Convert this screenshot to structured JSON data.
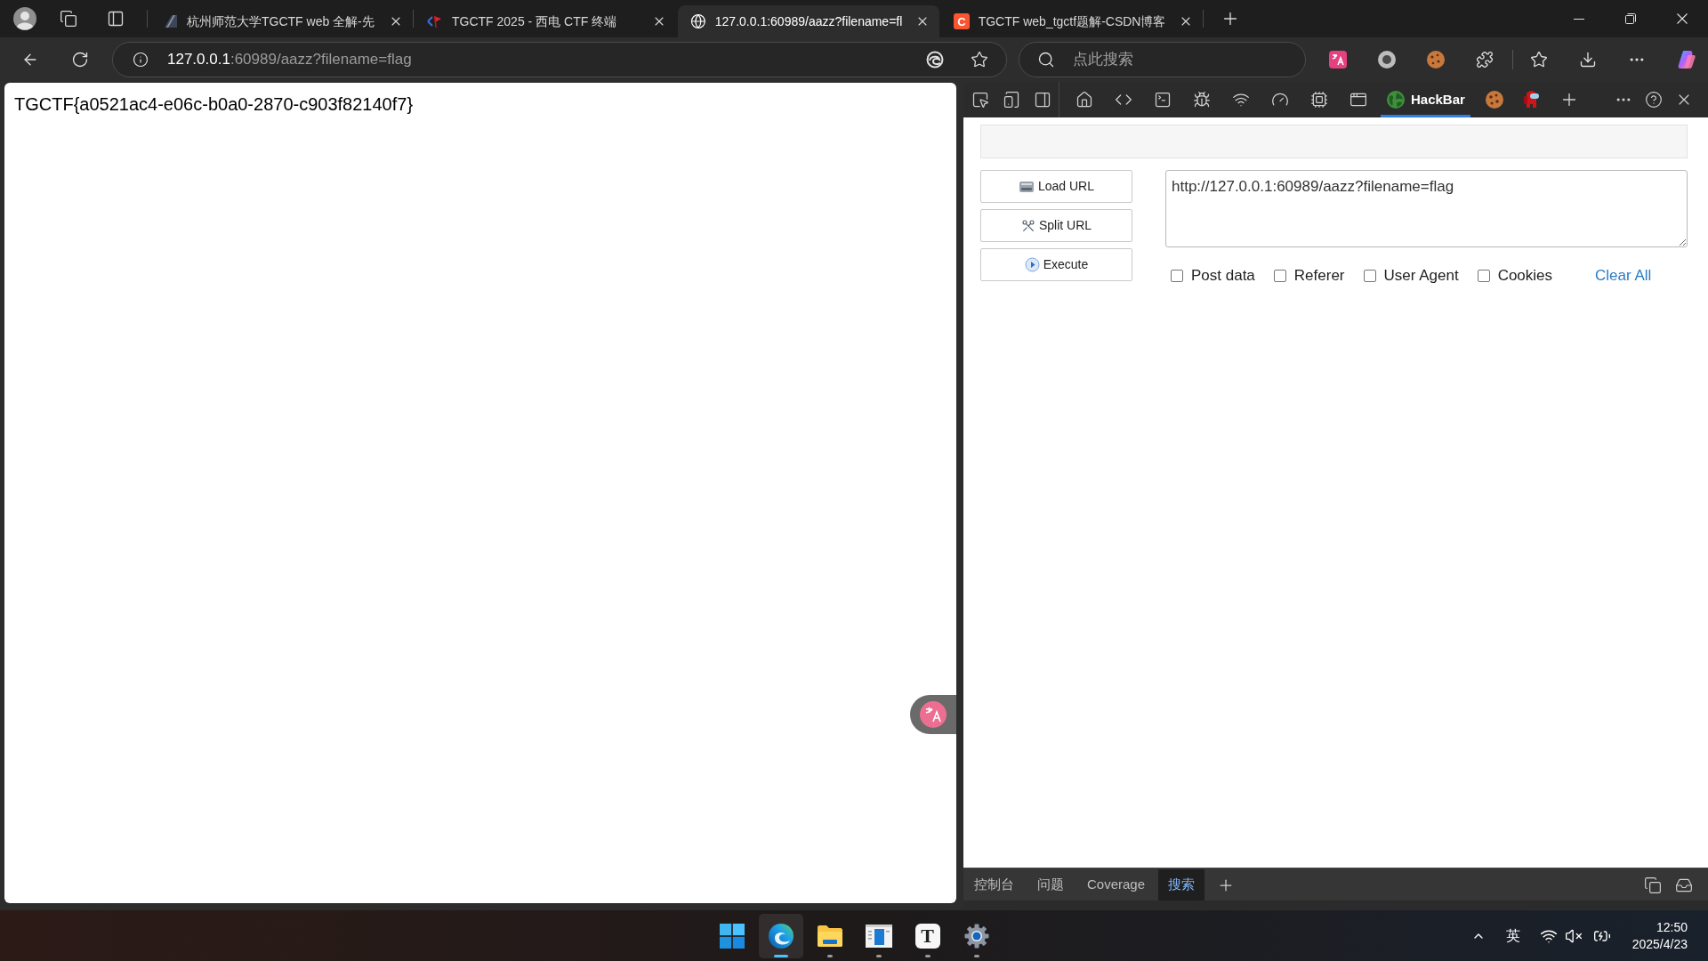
{
  "browser": {
    "tabs": [
      {
        "kind": "slash",
        "title": "杭州师范大学TGCTF web 全解-先",
        "selected": false
      },
      {
        "kind": "flag",
        "title": "TGCTF 2025 - 西电 CTF 终端",
        "selected": false
      },
      {
        "kind": "globe",
        "title": "127.0.0.1:60989/aazz?filename=fl",
        "selected": true
      },
      {
        "kind": "letter",
        "favicon_text": "C",
        "title": "TGCTF web_tgctf题解-CSDN博客",
        "selected": false
      }
    ],
    "address_bar": {
      "host": "127.0.0.1",
      "path": ":60989/aazz?filename=flag"
    },
    "search": {
      "placeholder": "点此搜索"
    }
  },
  "page": {
    "text": "TGCTF{a0521ac4-e06c-b0a0-2870-c903f82140f7}"
  },
  "devtools": {
    "tabs": [
      {
        "label": "HackBar",
        "selected": true
      }
    ],
    "hackbar": {
      "buttons": [
        {
          "kind": "load",
          "label": "Load URL"
        },
        {
          "kind": "split",
          "label": "Split URL"
        },
        {
          "kind": "execute",
          "label": "Execute"
        }
      ],
      "url": "http://127.0.0.1:60989/aazz?filename=flag",
      "options": [
        {
          "label": "Post data",
          "checked": false
        },
        {
          "label": "Referer",
          "checked": false
        },
        {
          "label": "User Agent",
          "checked": false
        },
        {
          "label": "Cookies",
          "checked": false
        }
      ],
      "clear_link": "Clear All"
    },
    "drawer_tabs": [
      {
        "label": "控制台",
        "selected": false
      },
      {
        "label": "问题",
        "selected": false
      },
      {
        "label": "Coverage",
        "selected": false
      },
      {
        "label": "搜索",
        "selected": true
      }
    ]
  },
  "taskbar": {
    "apps": [
      {
        "kind": "start",
        "running": false,
        "active": false
      },
      {
        "kind": "browser",
        "running": true,
        "active": true
      },
      {
        "kind": "folder",
        "running": true,
        "active": false
      },
      {
        "kind": "window",
        "running": true,
        "active": false
      },
      {
        "kind": "letter",
        "glyph": "T",
        "running": true,
        "active": false
      },
      {
        "kind": "gear",
        "running": true,
        "active": false
      }
    ],
    "tray": {
      "language": "英",
      "time": "12:50",
      "date": "2025/4/23"
    }
  }
}
